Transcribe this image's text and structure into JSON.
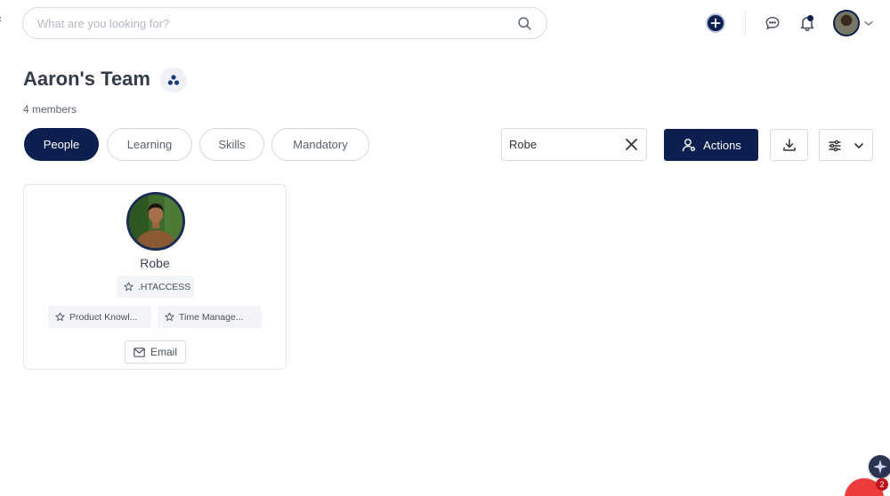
{
  "search": {
    "placeholder": "What are you looking for?",
    "value": ""
  },
  "header": {
    "icons": [
      "plus-circle-icon",
      "chat-icon",
      "bell-icon",
      "avatar",
      "chevron-down-icon"
    ]
  },
  "team": {
    "title": "Aaron's Team",
    "member_count": "4 members"
  },
  "tabs": [
    {
      "label": "People",
      "active": true
    },
    {
      "label": "Learning",
      "active": false
    },
    {
      "label": "Skills",
      "active": false
    },
    {
      "label": "Mandatory",
      "active": false
    }
  ],
  "filter": {
    "value": "Robe"
  },
  "toolbar": {
    "actions_label": "Actions"
  },
  "members": [
    {
      "name": "Robe",
      "skills": [
        ".HTACCESS",
        "Product Knowl...",
        "Time Manage..."
      ],
      "email_label": "Email"
    }
  ],
  "notifications": {
    "chat_count": "2"
  },
  "colors": {
    "primary": "#0d1f4f",
    "chip_bg": "#f2f4f8",
    "border": "#d7dbe2",
    "chat_fab": "#ee3b3b"
  }
}
